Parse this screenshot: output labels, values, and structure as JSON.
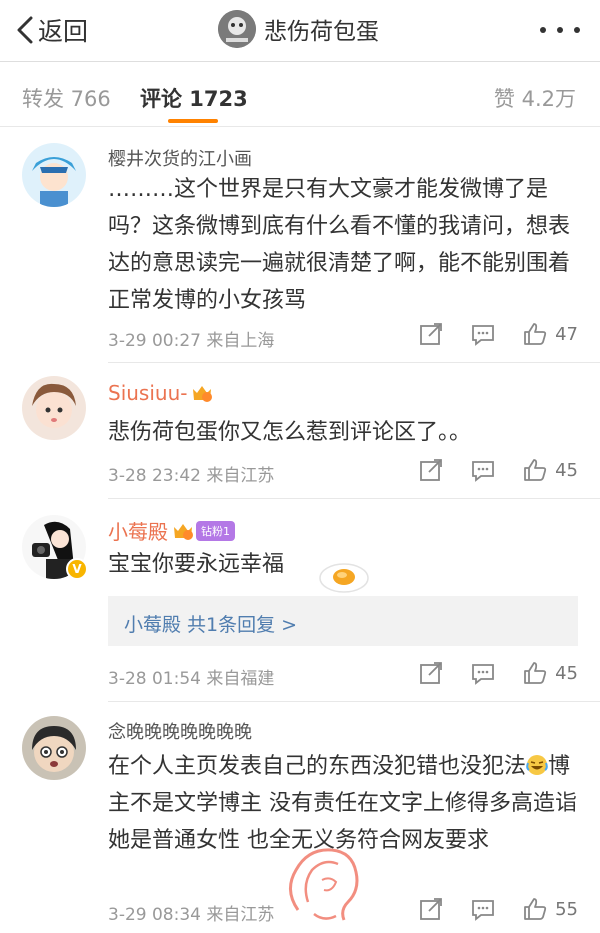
{
  "navbar": {
    "back_label": "返回",
    "title": "悲伤荷包蛋"
  },
  "tabs": {
    "repost": "转发 766",
    "comment": "评论 1723",
    "like": "赞 4.2万"
  },
  "comments": [
    {
      "username": "樱井次货的江小画",
      "text": "………这个世界是只有大文豪才能发微博了是吗？这条微博到底有什么看不懂的我请问，想表达的意思读完一遍就很清楚了啊，能不能别围着正常发博的小女孩骂",
      "meta": "3-29 00:27  来自上海",
      "likes": "47"
    },
    {
      "username": "Siusiuu-",
      "text": "悲伤荷包蛋你又怎么惹到评论区了。。",
      "meta": "3-28 23:42  来自江苏",
      "likes": "45"
    },
    {
      "username": "小莓殿",
      "fan_badge": "钻粉1",
      "text": "宝宝你要永远幸福",
      "reply_summary": "小莓殿  共1条回复 >",
      "meta": "3-28 01:54  来自福建",
      "likes": "45"
    },
    {
      "username": "念晚晚晚晚晚晚晚",
      "text_a": "在个人主页发表自己的东西没犯错也没犯法",
      "text_b": "博主不是文学博主 没有责任在文字上修得多高造诣 她是普通女性 也全无义务符合网友要求",
      "meta": "3-29 08:34  来自江苏",
      "likes": "55"
    }
  ],
  "colors": {
    "accent": "#ff8200",
    "username_vip": "#eb7350",
    "link": "#507daf"
  },
  "icons": [
    "back-chevron-icon",
    "more-icon",
    "repost-icon",
    "comment-icon",
    "like-icon",
    "crown-icon",
    "verified-icon",
    "egg-sticker",
    "crying-laugh-emoji"
  ]
}
